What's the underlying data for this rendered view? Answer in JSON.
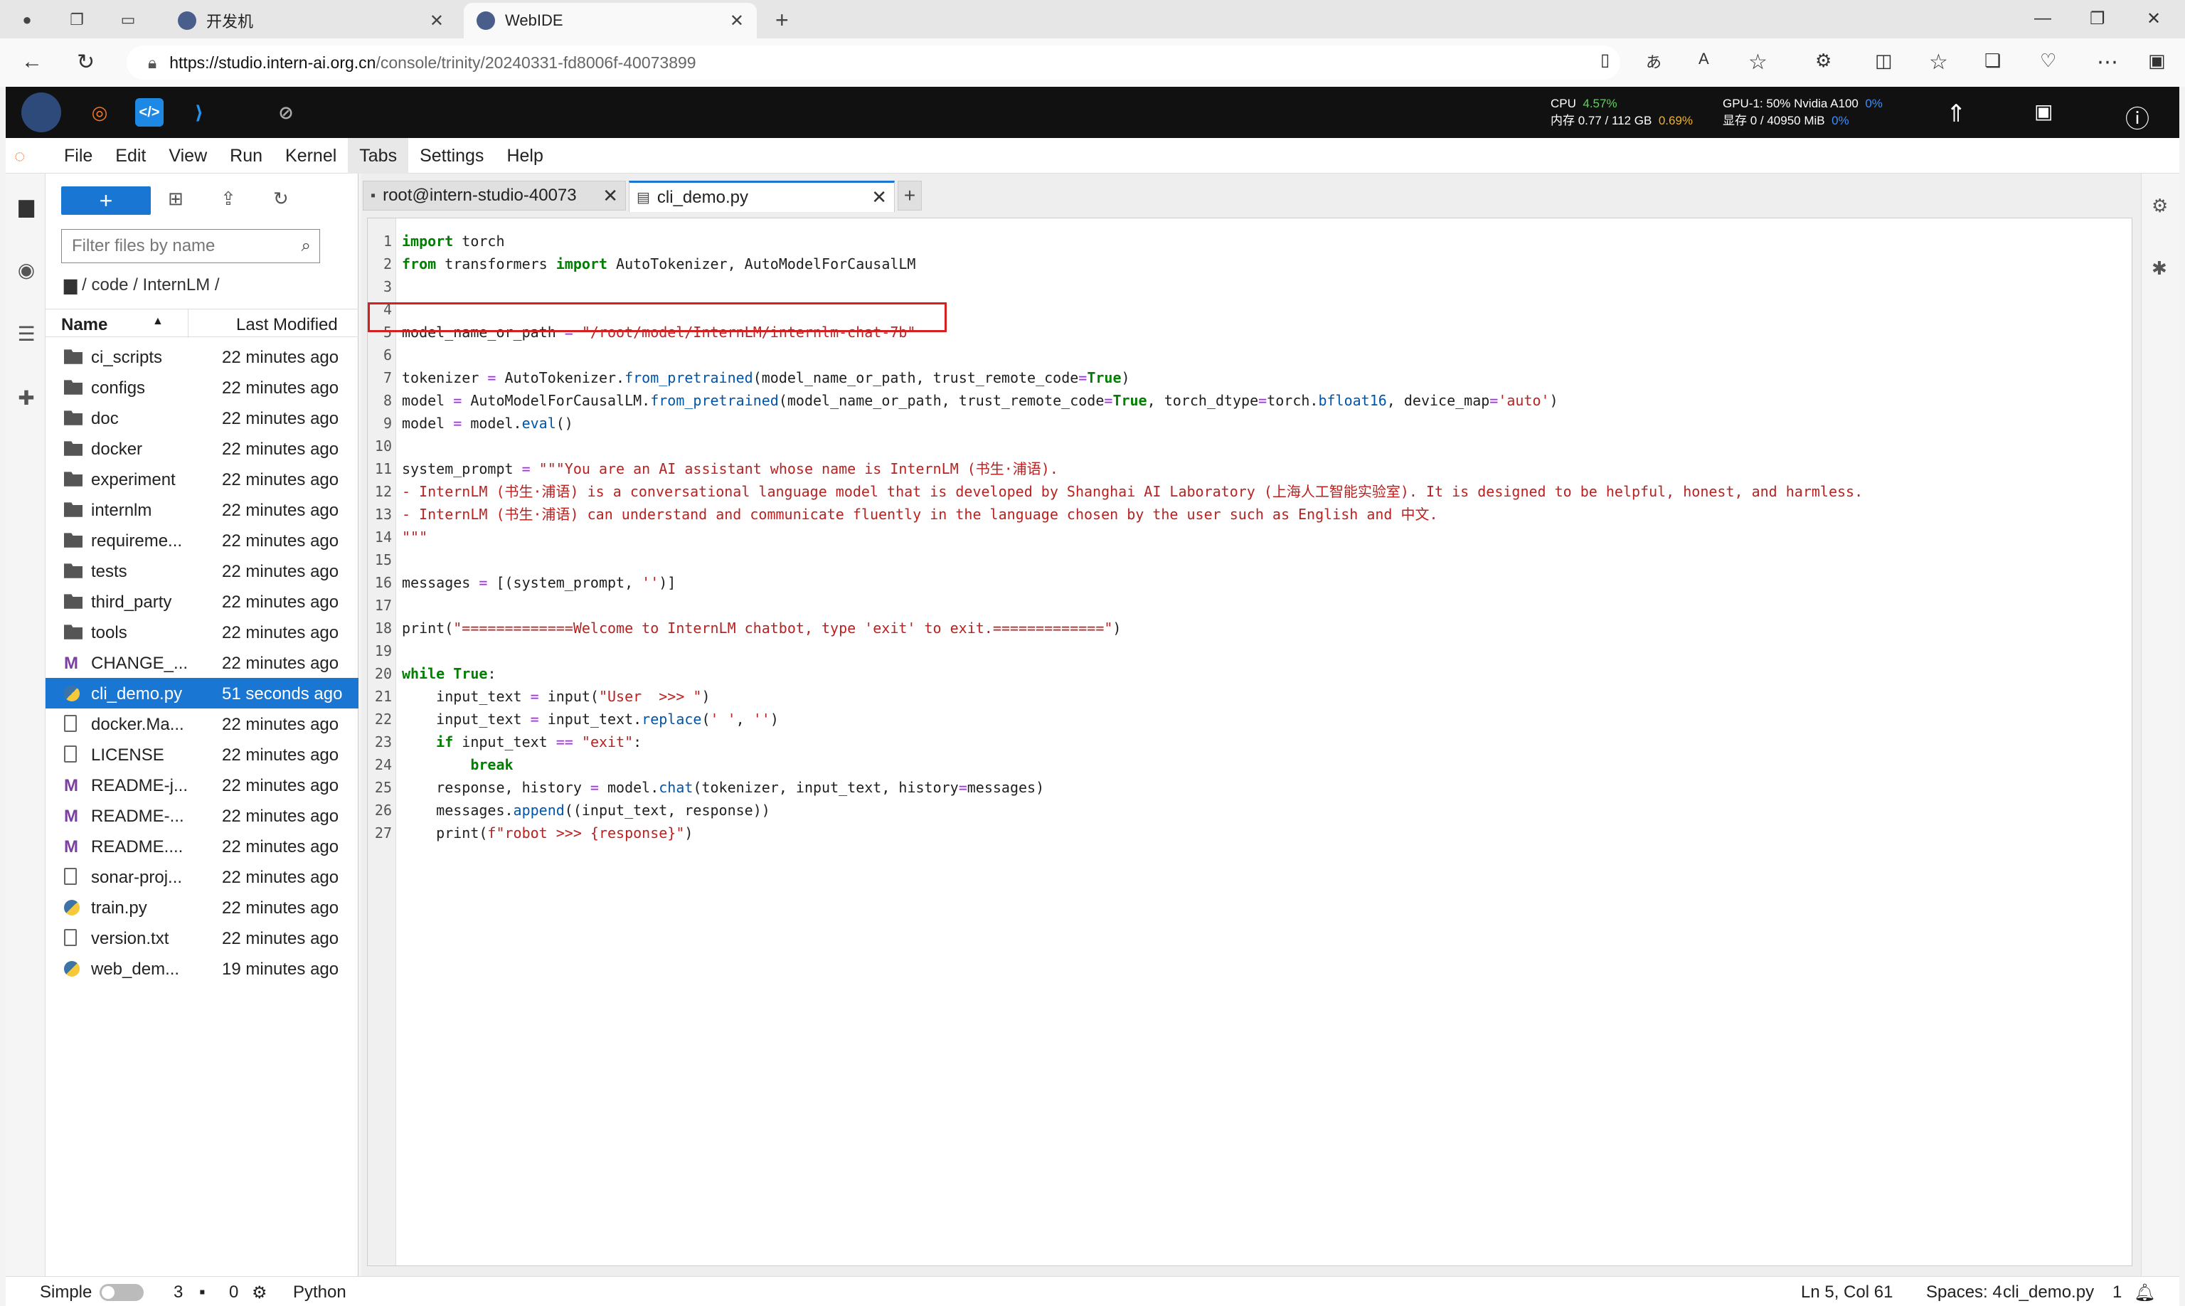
{
  "browser": {
    "tabs": [
      {
        "title": "开发机"
      },
      {
        "title": "WebIDE"
      }
    ],
    "url_host": "https://studio.intern-ai.org.cn",
    "url_path": "/console/trinity/20240331-fd8006f-40073899"
  },
  "topbar": {
    "cpu_label": "CPU",
    "cpu_value": "4.57%",
    "mem_label": "内存 0.77 / 112 GB",
    "mem_value": "0.69%",
    "gpu_label": "GPU-1: 50% Nvidia A100",
    "gpu_value": "0%",
    "vram_label": "显存 0 / 40950 MiB",
    "vram_value": "0%"
  },
  "menu": [
    "File",
    "Edit",
    "View",
    "Run",
    "Kernel",
    "Tabs",
    "Settings",
    "Help"
  ],
  "filebrowser": {
    "filter_placeholder": "Filter files by name",
    "breadcrumb": "/ code / InternLM /",
    "col_name": "Name",
    "col_modified": "Last Modified",
    "files": [
      {
        "name": "ci_scripts",
        "modified": "22 minutes ago",
        "type": "folder"
      },
      {
        "name": "configs",
        "modified": "22 minutes ago",
        "type": "folder"
      },
      {
        "name": "doc",
        "modified": "22 minutes ago",
        "type": "folder"
      },
      {
        "name": "docker",
        "modified": "22 minutes ago",
        "type": "folder"
      },
      {
        "name": "experiment",
        "modified": "22 minutes ago",
        "type": "folder"
      },
      {
        "name": "internlm",
        "modified": "22 minutes ago",
        "type": "folder"
      },
      {
        "name": "requireme...",
        "modified": "22 minutes ago",
        "type": "folder"
      },
      {
        "name": "tests",
        "modified": "22 minutes ago",
        "type": "folder"
      },
      {
        "name": "third_party",
        "modified": "22 minutes ago",
        "type": "folder"
      },
      {
        "name": "tools",
        "modified": "22 minutes ago",
        "type": "folder"
      },
      {
        "name": "CHANGE_...",
        "modified": "22 minutes ago",
        "type": "markdown"
      },
      {
        "name": "cli_demo.py",
        "modified": "51 seconds ago",
        "type": "python",
        "selected": true
      },
      {
        "name": "docker.Ma...",
        "modified": "22 minutes ago",
        "type": "file"
      },
      {
        "name": "LICENSE",
        "modified": "22 minutes ago",
        "type": "file"
      },
      {
        "name": "README-j...",
        "modified": "22 minutes ago",
        "type": "markdown"
      },
      {
        "name": "README-...",
        "modified": "22 minutes ago",
        "type": "markdown"
      },
      {
        "name": "README....",
        "modified": "22 minutes ago",
        "type": "markdown"
      },
      {
        "name": "sonar-proj...",
        "modified": "22 minutes ago",
        "type": "file"
      },
      {
        "name": "train.py",
        "modified": "22 minutes ago",
        "type": "python"
      },
      {
        "name": "version.txt",
        "modified": "22 minutes ago",
        "type": "file"
      },
      {
        "name": "web_dem...",
        "modified": "19 minutes ago",
        "type": "python"
      }
    ]
  },
  "editor_tabs": [
    {
      "label": "root@intern-studio-40073"
    },
    {
      "label": "cli_demo.py"
    }
  ],
  "code_lines": [
    "1",
    "2",
    "3",
    "4",
    "5",
    "6",
    "7",
    "8",
    "9",
    "10",
    "11",
    "12",
    "13",
    "14",
    "15",
    "16",
    "17",
    "18",
    "19",
    "20",
    "21",
    "22",
    "23",
    "24",
    "25",
    "26",
    "27"
  ],
  "statusbar": {
    "mode": "Simple",
    "terminals": "3",
    "kernels": "0",
    "language": "Python",
    "cursor": "Ln 5, Col 61",
    "spaces": "Spaces: 4",
    "file": "cli_demo.py",
    "notifications": "1"
  }
}
